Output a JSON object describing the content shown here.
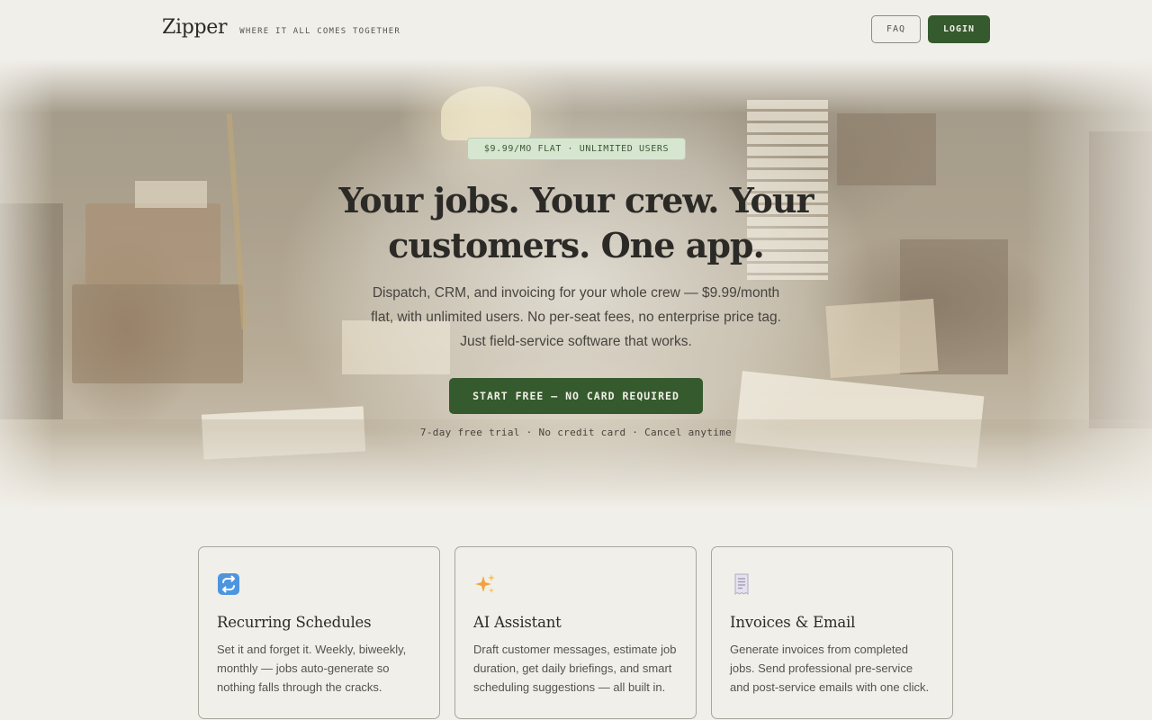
{
  "header": {
    "logo": "Zipper",
    "tagline": "WHERE IT ALL COMES TOGETHER",
    "faq_label": "FAQ",
    "login_label": "LOGIN"
  },
  "hero": {
    "pill": "$9.99/MO FLAT · UNLIMITED USERS",
    "headline_line1": "Your jobs. Your crew. Your",
    "headline_line2": "customers. One app.",
    "subtext_line1": "Dispatch, CRM, and invoicing for your whole crew — $9.99/month",
    "subtext_line2": "flat, with unlimited users. No per-seat fees, no enterprise price tag.",
    "subtext_line3": "Just field-service software that works.",
    "cta_label": "START FREE — NO CARD REQUIRED",
    "trial_note": "7-day free trial · No credit card · Cancel anytime"
  },
  "features": [
    {
      "icon": "repeat-icon",
      "title": "Recurring Schedules",
      "desc_line1": "Set it and forget it. Weekly, biweekly,",
      "desc_line2": "monthly — jobs auto-generate so",
      "desc_line3": "nothing falls through the cracks."
    },
    {
      "icon": "sparkles-icon",
      "title": "AI Assistant",
      "desc_line1": "Draft customer messages, estimate job",
      "desc_line2": "duration, get daily briefings, and smart",
      "desc_line3": "scheduling suggestions — all built in."
    },
    {
      "icon": "receipt-icon",
      "title": "Invoices & Email",
      "desc_line1": "Generate invoices from completed",
      "desc_line2": "jobs. Send professional pre-service",
      "desc_line3": "and post-service emails with one click."
    }
  ],
  "colors": {
    "background": "#f1efe9",
    "accent": "#355a2d",
    "pill_bg": "#d6e6d1",
    "text": "#2b2a26"
  }
}
